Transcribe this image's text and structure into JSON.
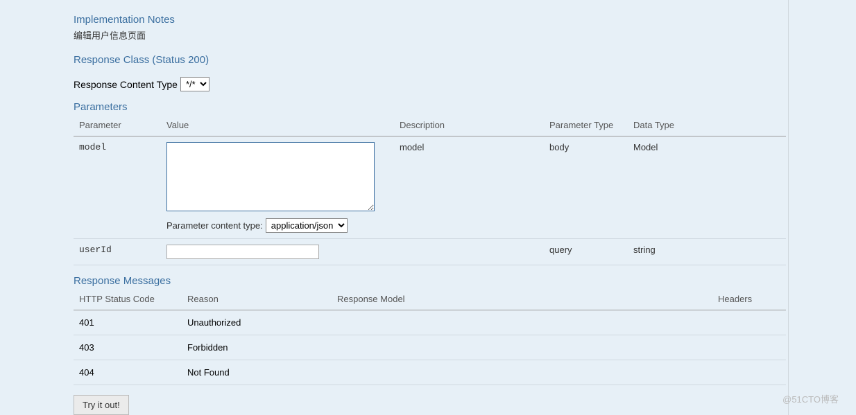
{
  "notes": {
    "heading": "Implementation Notes",
    "text": "编辑用户信息页面"
  },
  "response_class": {
    "heading": "Response Class (Status 200)"
  },
  "content_type": {
    "label": "Response Content Type",
    "selected": "*/*"
  },
  "parameters": {
    "heading": "Parameters",
    "columns": {
      "parameter": "Parameter",
      "value": "Value",
      "description": "Description",
      "parameter_type": "Parameter Type",
      "data_type": "Data Type"
    },
    "rows": [
      {
        "name": "model",
        "value": "",
        "description": "model",
        "parameter_type": "body",
        "data_type": "Model",
        "content_type_label": "Parameter content type:",
        "content_type_selected": "application/json"
      },
      {
        "name": "userId",
        "value": "",
        "description": "",
        "parameter_type": "query",
        "data_type": "string"
      }
    ]
  },
  "response_messages": {
    "heading": "Response Messages",
    "columns": {
      "code": "HTTP Status Code",
      "reason": "Reason",
      "model": "Response Model",
      "headers": "Headers"
    },
    "rows": [
      {
        "code": "401",
        "reason": "Unauthorized"
      },
      {
        "code": "403",
        "reason": "Forbidden"
      },
      {
        "code": "404",
        "reason": "Not Found"
      }
    ]
  },
  "actions": {
    "try_button": "Try it out!"
  },
  "watermark": "@51CTO博客"
}
